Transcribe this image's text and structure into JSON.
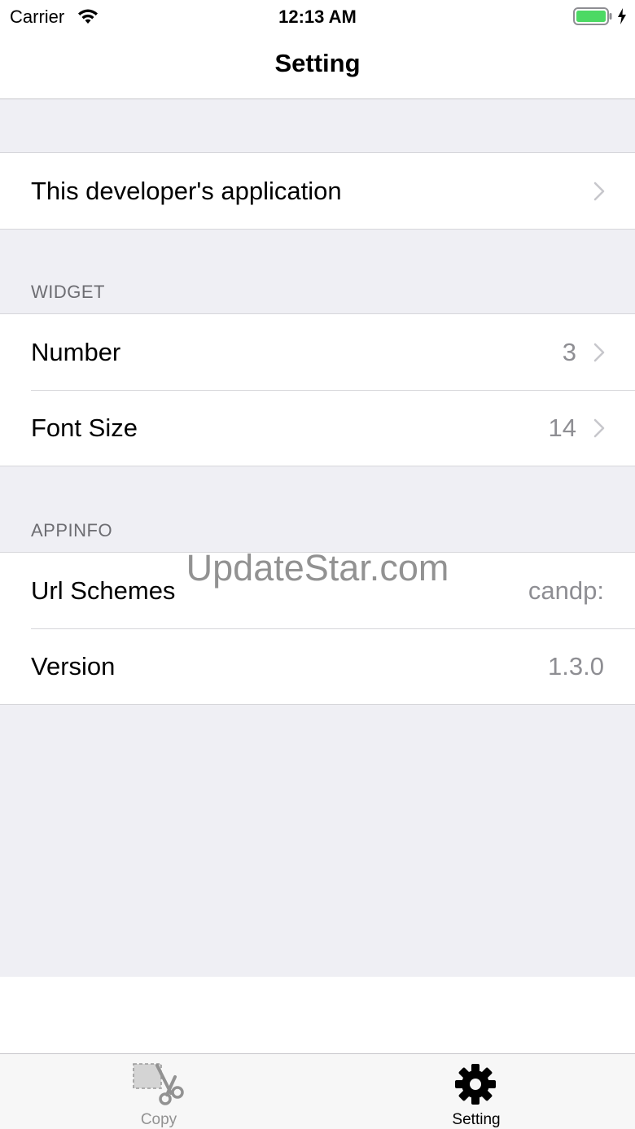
{
  "status": {
    "carrier": "Carrier",
    "time": "12:13 AM"
  },
  "nav": {
    "title": "Setting"
  },
  "groups": {
    "developer": {
      "label": "This developer's application"
    },
    "widget": {
      "header": "WIDGET",
      "rows": [
        {
          "label": "Number",
          "value": "3"
        },
        {
          "label": "Font Size",
          "value": "14"
        }
      ]
    },
    "appinfo": {
      "header": "APPINFO",
      "rows": [
        {
          "label": "Url Schemes",
          "value": "candp:"
        },
        {
          "label": "Version",
          "value": "1.3.0"
        }
      ]
    }
  },
  "watermark": "UpdateStar.com",
  "tabs": [
    {
      "label": "Copy",
      "icon": "scissors-icon",
      "selected": false
    },
    {
      "label": "Setting",
      "icon": "gear-icon",
      "selected": true
    }
  ],
  "colors": {
    "background": "#efeff4",
    "secondary_text": "#8e8e93",
    "battery_green": "#4cd964",
    "tab_inactive": "#929292",
    "tab_active": "#000000"
  }
}
